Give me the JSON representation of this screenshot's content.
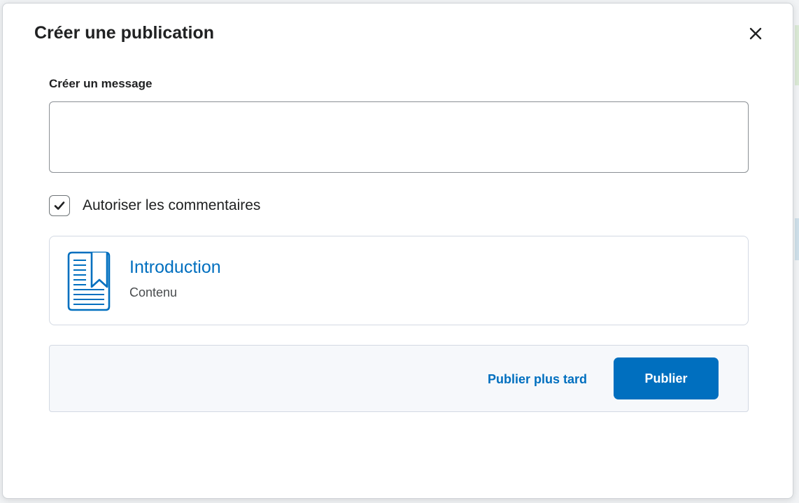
{
  "dialog": {
    "title": "Créer une publication",
    "close_icon": "close-icon"
  },
  "message": {
    "label": "Créer un message",
    "value": "",
    "placeholder": ""
  },
  "allow_comments": {
    "label": "Autoriser les commentaires",
    "checked": true,
    "icon": "checkmark-icon"
  },
  "content_item": {
    "title": "Introduction",
    "type": "Contenu",
    "icon": "book-bookmark-icon"
  },
  "actions": {
    "publish_later_label": "Publier plus tard",
    "publish_label": "Publier"
  },
  "colors": {
    "accent": "#006fbf",
    "text": "#202122",
    "footer_bg": "#f6f8fb"
  }
}
